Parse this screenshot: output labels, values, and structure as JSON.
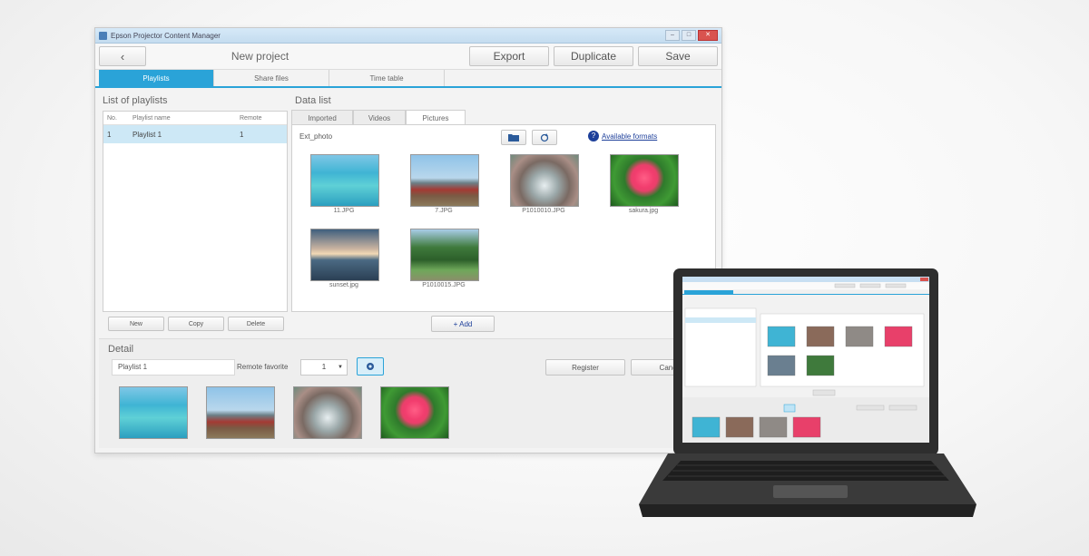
{
  "window": {
    "title": "Epson Projector Content Manager",
    "controls": {
      "minimize": "–",
      "maximize": "□",
      "close": "✕"
    }
  },
  "toolbar": {
    "back_label": "‹",
    "project_title": "New project",
    "export_label": "Export",
    "duplicate_label": "Duplicate",
    "save_label": "Save"
  },
  "tabs": [
    {
      "label": "Playlists",
      "active": true
    },
    {
      "label": "Share files",
      "active": false
    },
    {
      "label": "Time table",
      "active": false
    }
  ],
  "playlists": {
    "heading": "List of playlists",
    "columns": [
      "No.",
      "Playlist name",
      "Remote"
    ],
    "rows": [
      {
        "no": "1",
        "name": "Playlist 1",
        "remote": "1"
      }
    ],
    "new_label": "New",
    "copy_label": "Copy",
    "delete_label": "Delete"
  },
  "data_list": {
    "heading": "Data list",
    "subtabs": [
      "Imported",
      "Videos",
      "Pictures"
    ],
    "active_subtab": "Pictures",
    "folder_path": "Ext_photo",
    "available_formats_label": "Available formats",
    "add_label": "+ Add",
    "items": [
      {
        "filename": "11.JPG",
        "image": "turquoise-sea"
      },
      {
        "filename": "7.JPG",
        "image": "red-boat-harbor"
      },
      {
        "filename": "P1010010.JPG",
        "image": "waterfall-rocks"
      },
      {
        "filename": "sakura.jpg",
        "image": "pink-hibiscus"
      },
      {
        "filename": "sunset.jpg",
        "image": "sunset-sea"
      },
      {
        "filename": "P1010015.JPG",
        "image": "green-hill"
      }
    ]
  },
  "detail": {
    "heading": "Detail",
    "playlist_name_value": "Playlist 1",
    "remote_favorite_label": "Remote favorite",
    "remote_favorite_value": "1",
    "register_label": "Register",
    "cancel_label": "Cancel",
    "thumbnails": [
      "turquoise-sea",
      "red-boat-harbor",
      "waterfall-rocks",
      "pink-hibiscus"
    ]
  },
  "colors": {
    "accent": "#2aa3d8",
    "selection": "#cde8f6",
    "laptop_body": "#3a3a3a"
  }
}
